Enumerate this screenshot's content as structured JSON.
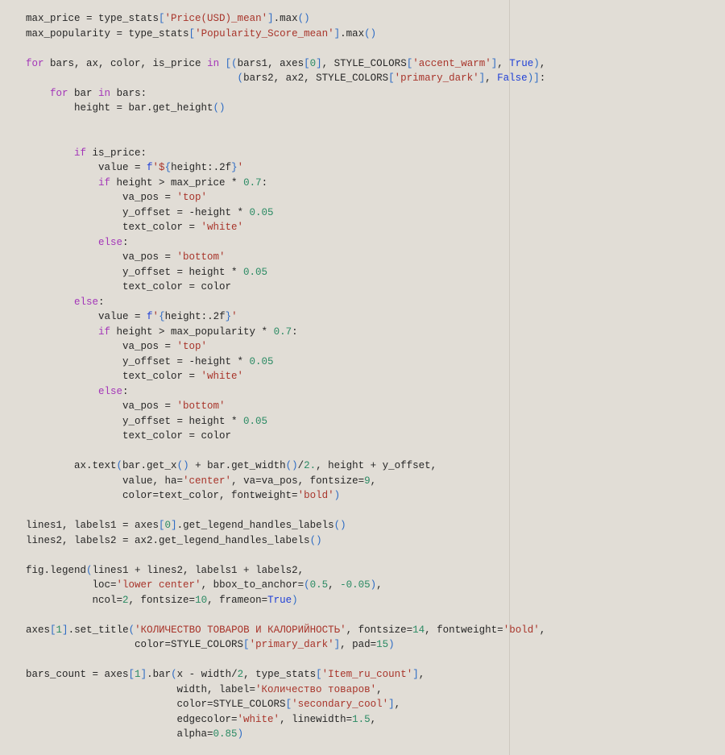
{
  "code": {
    "lines": [
      [
        [
          "",
          "max_price = type_stats"
        ],
        [
          "p",
          "["
        ],
        [
          "s",
          "'Price(USD)_mean'"
        ],
        [
          "p",
          "]"
        ],
        [
          "",
          ".max"
        ],
        [
          "p",
          "()"
        ]
      ],
      [
        [
          "",
          "max_popularity = type_stats"
        ],
        [
          "p",
          "["
        ],
        [
          "s",
          "'Popularity_Score_mean'"
        ],
        [
          "p",
          "]"
        ],
        [
          "",
          ".max"
        ],
        [
          "p",
          "()"
        ]
      ],
      [],
      [
        [
          "k",
          "for"
        ],
        [
          "",
          " bars, ax, color, is_price "
        ],
        [
          "k",
          "in"
        ],
        [
          "",
          " "
        ],
        [
          "p",
          "[("
        ],
        [
          "",
          "bars1, axes"
        ],
        [
          "p",
          "["
        ],
        [
          "n",
          "0"
        ],
        [
          "p",
          "]"
        ],
        [
          "",
          ", STYLE_COLORS"
        ],
        [
          "p",
          "["
        ],
        [
          "s",
          "'accent_warm'"
        ],
        [
          "p",
          "]"
        ],
        [
          "",
          ", "
        ],
        [
          "b",
          "True"
        ],
        [
          "p",
          ")"
        ],
        [
          "",
          ","
        ]
      ],
      [
        [
          "",
          "                                   "
        ],
        [
          "p",
          "("
        ],
        [
          "",
          "bars2, ax2, STYLE_COLORS"
        ],
        [
          "p",
          "["
        ],
        [
          "s",
          "'primary_dark'"
        ],
        [
          "p",
          "]"
        ],
        [
          "",
          ", "
        ],
        [
          "b",
          "False"
        ],
        [
          "p",
          ")]"
        ],
        [
          "",
          ":"
        ]
      ],
      [
        [
          "",
          "    "
        ],
        [
          "k",
          "for"
        ],
        [
          "",
          " bar "
        ],
        [
          "k",
          "in"
        ],
        [
          "",
          " bars:"
        ]
      ],
      [
        [
          "",
          "        height = bar.get_height"
        ],
        [
          "p",
          "()"
        ]
      ],
      [],
      [],
      [
        [
          "",
          "        "
        ],
        [
          "k",
          "if"
        ],
        [
          "",
          " is_price:"
        ]
      ],
      [
        [
          "",
          "            value = "
        ],
        [
          "b",
          "f"
        ],
        [
          "s",
          "'$"
        ],
        [
          "p",
          "{"
        ],
        [
          "",
          "height:.2f"
        ],
        [
          "p",
          "}"
        ],
        [
          "s",
          "'"
        ]
      ],
      [
        [
          "",
          "            "
        ],
        [
          "k",
          "if"
        ],
        [
          "",
          " height > max_price * "
        ],
        [
          "n",
          "0.7"
        ],
        [
          "",
          ":"
        ]
      ],
      [
        [
          "",
          "                va_pos = "
        ],
        [
          "s",
          "'top'"
        ]
      ],
      [
        [
          "",
          "                y_offset = -height * "
        ],
        [
          "n",
          "0.05"
        ]
      ],
      [
        [
          "",
          "                text_color = "
        ],
        [
          "s",
          "'white'"
        ]
      ],
      [
        [
          "",
          "            "
        ],
        [
          "k",
          "else"
        ],
        [
          "",
          ":"
        ]
      ],
      [
        [
          "",
          "                va_pos = "
        ],
        [
          "s",
          "'bottom'"
        ]
      ],
      [
        [
          "",
          "                y_offset = height * "
        ],
        [
          "n",
          "0.05"
        ]
      ],
      [
        [
          "",
          "                text_color = color"
        ]
      ],
      [
        [
          "",
          "        "
        ],
        [
          "k",
          "else"
        ],
        [
          "",
          ":"
        ]
      ],
      [
        [
          "",
          "            value = "
        ],
        [
          "b",
          "f"
        ],
        [
          "s",
          "'"
        ],
        [
          "p",
          "{"
        ],
        [
          "",
          "height:.2f"
        ],
        [
          "p",
          "}"
        ],
        [
          "s",
          "'"
        ]
      ],
      [
        [
          "",
          "            "
        ],
        [
          "k",
          "if"
        ],
        [
          "",
          " height > max_popularity * "
        ],
        [
          "n",
          "0.7"
        ],
        [
          "",
          ":"
        ]
      ],
      [
        [
          "",
          "                va_pos = "
        ],
        [
          "s",
          "'top'"
        ]
      ],
      [
        [
          "",
          "                y_offset = -height * "
        ],
        [
          "n",
          "0.05"
        ]
      ],
      [
        [
          "",
          "                text_color = "
        ],
        [
          "s",
          "'white'"
        ]
      ],
      [
        [
          "",
          "            "
        ],
        [
          "k",
          "else"
        ],
        [
          "",
          ":"
        ]
      ],
      [
        [
          "",
          "                va_pos = "
        ],
        [
          "s",
          "'bottom'"
        ]
      ],
      [
        [
          "",
          "                y_offset = height * "
        ],
        [
          "n",
          "0.05"
        ]
      ],
      [
        [
          "",
          "                text_color = color"
        ]
      ],
      [],
      [
        [
          "",
          "        ax.text"
        ],
        [
          "p",
          "("
        ],
        [
          "",
          "bar.get_x"
        ],
        [
          "p",
          "()"
        ],
        [
          "",
          " + bar.get_width"
        ],
        [
          "p",
          "()"
        ],
        [
          "",
          "/"
        ],
        [
          "n",
          "2."
        ],
        [
          "",
          ", height + y_offset,"
        ]
      ],
      [
        [
          "",
          "                value, ha="
        ],
        [
          "s",
          "'center'"
        ],
        [
          "",
          ", va=va_pos, fontsize="
        ],
        [
          "n",
          "9"
        ],
        [
          "",
          ","
        ]
      ],
      [
        [
          "",
          "                color=text_color, fontweight="
        ],
        [
          "s",
          "'bold'"
        ],
        [
          "p",
          ")"
        ]
      ],
      [],
      [
        [
          "",
          "lines1, labels1 = axes"
        ],
        [
          "p",
          "["
        ],
        [
          "n",
          "0"
        ],
        [
          "p",
          "]"
        ],
        [
          "",
          ".get_legend_handles_labels"
        ],
        [
          "p",
          "()"
        ]
      ],
      [
        [
          "",
          "lines2, labels2 = ax2.get_legend_handles_labels"
        ],
        [
          "p",
          "()"
        ]
      ],
      [],
      [
        [
          "",
          "fig.legend"
        ],
        [
          "p",
          "("
        ],
        [
          "",
          "lines1 + lines2, labels1 + labels2,"
        ]
      ],
      [
        [
          "",
          "           loc="
        ],
        [
          "s",
          "'lower center'"
        ],
        [
          "",
          ", bbox_to_anchor="
        ],
        [
          "p",
          "("
        ],
        [
          "n",
          "0.5"
        ],
        [
          "",
          ", "
        ],
        [
          "n",
          "-0.05"
        ],
        [
          "p",
          ")"
        ],
        [
          "",
          ","
        ]
      ],
      [
        [
          "",
          "           ncol="
        ],
        [
          "n",
          "2"
        ],
        [
          "",
          ", fontsize="
        ],
        [
          "n",
          "10"
        ],
        [
          "",
          ", frameon="
        ],
        [
          "b",
          "True"
        ],
        [
          "p",
          ")"
        ]
      ],
      [],
      [
        [
          "",
          "axes"
        ],
        [
          "p",
          "["
        ],
        [
          "n",
          "1"
        ],
        [
          "p",
          "]"
        ],
        [
          "",
          ".set_title"
        ],
        [
          "p",
          "("
        ],
        [
          "s",
          "'КОЛИЧЕСТВО ТОВАРОВ И КАЛОРИЙНОСТЬ'"
        ],
        [
          "",
          ", fontsize="
        ],
        [
          "n",
          "14"
        ],
        [
          "",
          ", fontweight="
        ],
        [
          "s",
          "'bold'"
        ],
        [
          "",
          ","
        ]
      ],
      [
        [
          "",
          "                  color=STYLE_COLORS"
        ],
        [
          "p",
          "["
        ],
        [
          "s",
          "'primary_dark'"
        ],
        [
          "p",
          "]"
        ],
        [
          "",
          ", pad="
        ],
        [
          "n",
          "15"
        ],
        [
          "p",
          ")"
        ]
      ],
      [],
      [
        [
          "",
          "bars_count = axes"
        ],
        [
          "p",
          "["
        ],
        [
          "n",
          "1"
        ],
        [
          "p",
          "]"
        ],
        [
          "",
          ".bar"
        ],
        [
          "p",
          "("
        ],
        [
          "",
          "x - width/"
        ],
        [
          "n",
          "2"
        ],
        [
          "",
          ", type_stats"
        ],
        [
          "p",
          "["
        ],
        [
          "s",
          "'Item_ru_count'"
        ],
        [
          "p",
          "]"
        ],
        [
          "",
          ","
        ]
      ],
      [
        [
          "",
          "                         width, label="
        ],
        [
          "s",
          "'Количество товаров'"
        ],
        [
          "",
          ","
        ]
      ],
      [
        [
          "",
          "                         color=STYLE_COLORS"
        ],
        [
          "p",
          "["
        ],
        [
          "s",
          "'secondary_cool'"
        ],
        [
          "p",
          "]"
        ],
        [
          "",
          ","
        ]
      ],
      [
        [
          "",
          "                         edgecolor="
        ],
        [
          "s",
          "'white'"
        ],
        [
          "",
          ", linewidth="
        ],
        [
          "n",
          "1.5"
        ],
        [
          "",
          ","
        ]
      ],
      [
        [
          "",
          "                         alpha="
        ],
        [
          "n",
          "0.85"
        ],
        [
          "p",
          ")"
        ]
      ]
    ]
  }
}
